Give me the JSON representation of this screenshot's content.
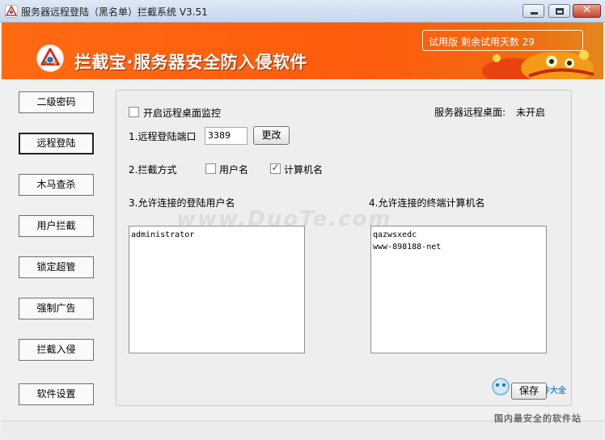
{
  "window": {
    "title": "服务器远程登陆（黑名单）拦截系统 V3.51"
  },
  "banner": {
    "title": "拦截宝·服务器安全防入侵软件",
    "trial_text": "试用版 剩余试用天数 29",
    "accent": "#ff5b0e"
  },
  "nav": {
    "items": [
      "二级密码",
      "远程登陆",
      "木马查杀",
      "用户拦截",
      "锁定超管",
      "强制广告",
      "拦截入侵",
      "软件设置"
    ],
    "active": "远程登陆"
  },
  "panel": {
    "monitor_label": "开启远程桌面监控",
    "monitor_checked": false,
    "remote_status_label": "服务器远程桌面:",
    "remote_status_value": "未开启",
    "port_label": "1.远程登陆端口",
    "port_value": "3389",
    "change_button": "更改",
    "block_mode_label": "2.拦截方式",
    "username_option": "用户名",
    "username_checked": false,
    "computer_option": "计算机名",
    "computer_checked": true,
    "allowed_users_label": "3.允许连接的登陆用户名",
    "allowed_users": [
      "administrator"
    ],
    "allowed_computers_label": "4.允许连接的终端计算机名",
    "allowed_computers": [
      "qazwsxedc",
      "www-898188-net"
    ],
    "save_button": "保存"
  },
  "watermarks": {
    "center": "www.DuoTe.com",
    "corner": "2345软件大全",
    "corner_sub": "国内最安全的软件站"
  }
}
